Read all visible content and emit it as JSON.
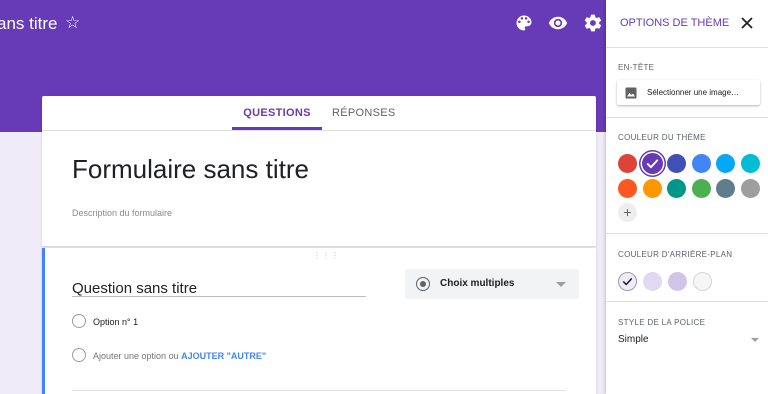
{
  "header": {
    "form_name": "ans titre",
    "icons": [
      "star-icon",
      "palette-icon",
      "preview-eye-icon",
      "settings-gear-icon"
    ]
  },
  "tabs": [
    {
      "label": "QUESTIONS",
      "active": true
    },
    {
      "label": "RÉPONSES",
      "active": false
    }
  ],
  "form": {
    "title": "Formulaire sans titre",
    "description_placeholder": "Description du formulaire"
  },
  "question": {
    "title": "Question sans titre",
    "type": "Choix multiples",
    "option_1": "Option n° 1",
    "add_option": "Ajouter une option",
    "or": "ou",
    "add_other": "AJOUTER \"AUTRE\""
  },
  "theme_panel": {
    "title": "OPTIONS DE THÈME",
    "header_section": "EN-TÊTE",
    "select_image": "Sélectionner une image…",
    "theme_color_section": "COULEUR DU THÈME",
    "theme_colors": [
      "#db4437",
      "#673ab7",
      "#3f51b5",
      "#4285f4",
      "#03a9f4",
      "#00bcd4",
      "#ff5722",
      "#ff9800",
      "#009688",
      "#4caf50",
      "#607d8b",
      "#9e9e9e"
    ],
    "selected_theme_color": "#673ab7",
    "add_color": "+",
    "background_section": "COULEUR D'ARRIÈRE-PLAN",
    "background_colors": [
      "#f0ebf8",
      "#e1d8f1",
      "#d1c4e9",
      "#f6f6f6"
    ],
    "selected_background_color": "#f0ebf8",
    "font_section": "STYLE DE LA POLICE",
    "font_value": "Simple"
  }
}
